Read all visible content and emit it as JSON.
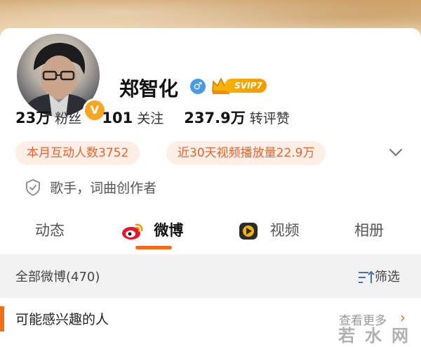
{
  "profile": {
    "name": "郑智化",
    "vip_label": "SVIP7",
    "verified_badge": "V",
    "gender_symbol": "♂",
    "verification_text": "歌手，词曲创作者"
  },
  "stats": [
    {
      "value": "23万",
      "label": "粉丝"
    },
    {
      "value": "101",
      "label": "关注"
    },
    {
      "value": "237.9万",
      "label": "转评赞"
    }
  ],
  "pills": [
    "本月互动人数3752",
    "近30天视频播放量22.9万"
  ],
  "tabs": [
    {
      "label": "动态",
      "icon": ""
    },
    {
      "label": "微博",
      "icon": "weibo-icon"
    },
    {
      "label": "视频",
      "icon": "video-icon"
    },
    {
      "label": "相册",
      "icon": ""
    }
  ],
  "active_tab": "微博",
  "feed": {
    "all_label": "全部微博(470)",
    "filter_label": "筛选"
  },
  "interest": {
    "title": "可能感兴趣的人",
    "more": "查看更多",
    "arrow": "›"
  },
  "watermark": "若水网",
  "colors": {
    "accent": "#f36b1c",
    "pill_bg": "#fdeee6",
    "pill_text": "#e8642f",
    "vip_gold": "#f6b300",
    "gender_blue": "#4a9be6"
  }
}
